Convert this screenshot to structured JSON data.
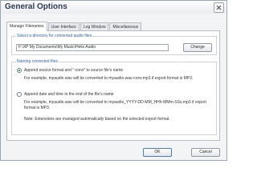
{
  "window": {
    "title": "General Options"
  },
  "tabs": [
    {
      "label": "Manage Filenames",
      "active": true
    },
    {
      "label": "User Interface",
      "active": false
    },
    {
      "label": "Log Window",
      "active": false
    },
    {
      "label": "Miscellaneous",
      "active": false
    }
  ],
  "directory_group": {
    "title": "Select a directory for converted audio files",
    "path_value": "F:\\XP My Documents\\My Music\\Helix Audio",
    "change_label": "Change"
  },
  "naming_group": {
    "title": "Naming converted files",
    "option1": {
      "label": "Append source format and \"-conv\" to source file's name",
      "checked": true,
      "example": "For example, myaudio.wav will be converted to myaudio.wav-conv.mp3 if export format is MP3."
    },
    "option2": {
      "label": "Append date and time to the end of the file's name",
      "checked": false,
      "example": "For example, myaudio.wav will be converted to myaudio_YYYY-DD-MM_HHh-MMm-SSs.mp3 if export format is MP3."
    },
    "note": "Note: Extensions are managed automatically based on the selected export format."
  },
  "footer": {
    "ok_label": "OK",
    "cancel_label": "Cancel"
  },
  "colors": {
    "accent": "#2f5fa6",
    "title_text": "#2b3b55"
  }
}
